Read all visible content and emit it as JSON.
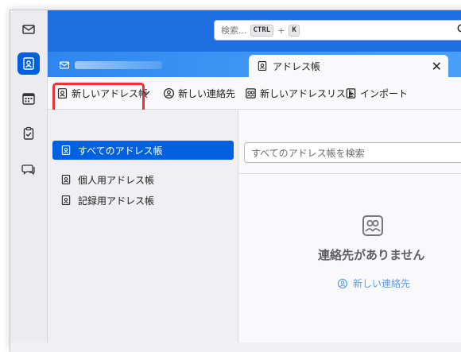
{
  "search": {
    "placeholder": "検索...",
    "shortcut_key1": "CTRL",
    "plus": "+",
    "shortcut_key2": "K"
  },
  "tabs": {
    "active_tab_label": "アドレス帳",
    "close_glyph": "✕"
  },
  "toolbar": {
    "new_address_book": "新しいアドレス帳",
    "new_contact": "新しい連絡先",
    "new_address_list": "新しいアドレスリスト",
    "import": "インポート"
  },
  "sidebar": {
    "items": [
      {
        "label": "すべてのアドレス帳"
      },
      {
        "label": "個人用アドレス帳"
      },
      {
        "label": "記録用アドレス帳"
      }
    ]
  },
  "main": {
    "filter_placeholder": "すべてのアドレス帳を検索",
    "empty_title": "連絡先がありません",
    "empty_link": "新しい連絡先"
  },
  "colors": {
    "accent": "#0061e0",
    "titlebar": "#1f6fe0",
    "highlight": "#e53535"
  },
  "icons": [
    "mail-icon",
    "address-book-icon",
    "calendar-icon",
    "tasks-icon",
    "chat-icon",
    "search-icon",
    "close-icon",
    "contact-icon",
    "import-icon",
    "chevron-down-icon"
  ]
}
